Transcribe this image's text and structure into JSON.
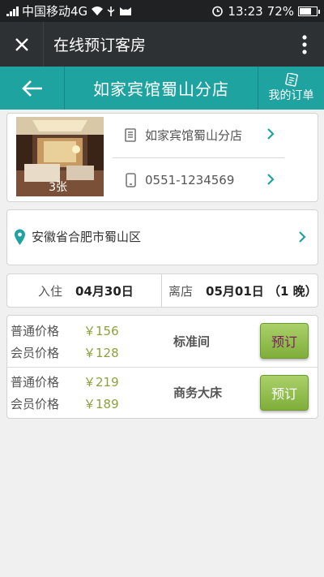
{
  "status_bar": {
    "carrier": "中国移动4G",
    "time": "13:23",
    "battery": "72%",
    "battery_level": 0.72
  },
  "wechat_bar": {
    "title": "在线预订客房",
    "close_icon": "close-icon",
    "more_icon": "more-vertical-icon"
  },
  "app_bar": {
    "title": "如家宾馆蜀山分店",
    "my_orders": "我的订单",
    "back_icon": "arrow-left-icon"
  },
  "hotel": {
    "photo_count": "3张",
    "name": "如家宾馆蜀山分店",
    "phone": "0551-1234569"
  },
  "address": {
    "text": "安徽省合肥市蜀山区"
  },
  "dates": {
    "checkin_label": "入住",
    "checkin_value": "04月30日",
    "checkout_label": "离店",
    "checkout_value": "05月01日 （1 晚）"
  },
  "rooms": [
    {
      "name": "标准间",
      "regular_label": "普通价格",
      "regular_price": "￥156",
      "member_label": "会员价格",
      "member_price": "￥128",
      "book_label": "预订",
      "book_color": "#7a1e5a"
    },
    {
      "name": "商务大床",
      "regular_label": "普通价格",
      "regular_price": "￥219",
      "member_label": "会员价格",
      "member_price": "￥189",
      "book_label": "预订",
      "book_color": "#ffffff"
    }
  ],
  "colors": {
    "teal": "#1fa3a0",
    "price": "#8aa23c",
    "book_green": "#8dbd48"
  }
}
